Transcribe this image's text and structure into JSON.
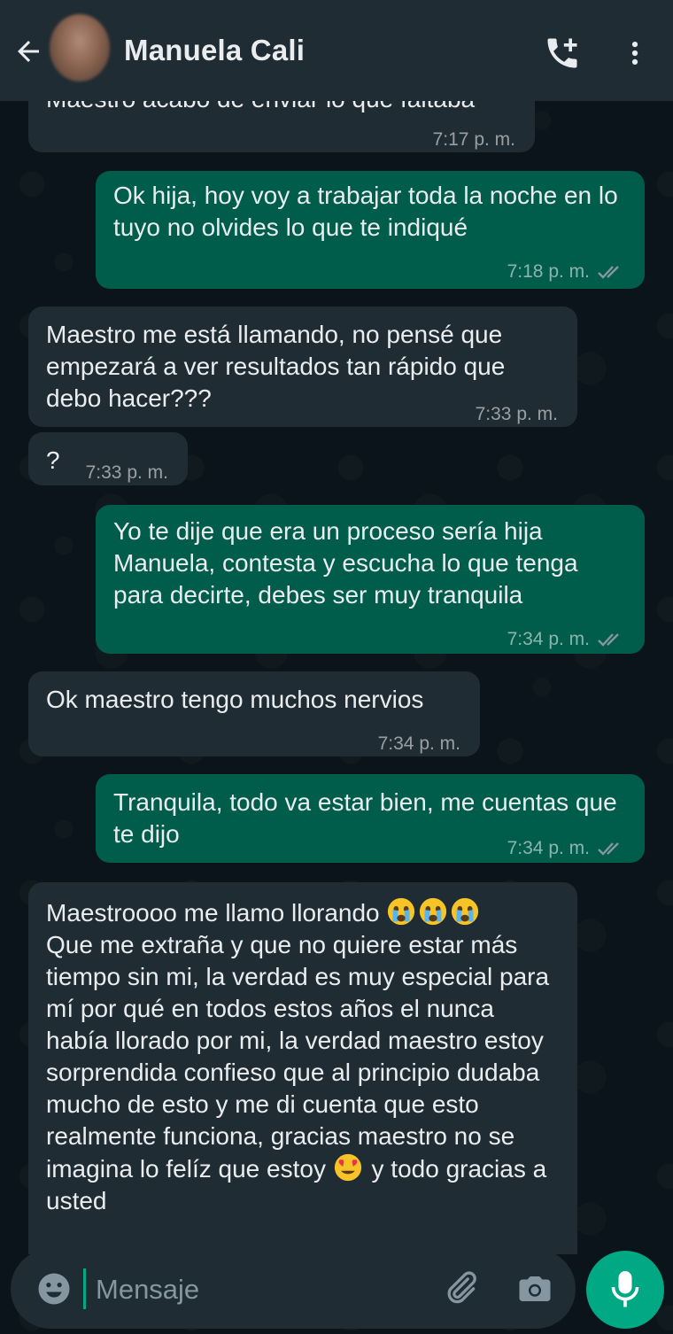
{
  "header": {
    "contact_name": "Manuela Cali"
  },
  "messages": [
    {
      "direction": "incoming",
      "text": "Maestro acabo de enviar lo que faltaba",
      "time": "7:17 p. m."
    },
    {
      "direction": "outgoing",
      "text": "Ok hija, hoy voy a trabajar toda la noche en lo tuyo no olvides lo que te indiqué",
      "time": "7:18 p. m.",
      "status": "read"
    },
    {
      "direction": "incoming",
      "text": "Maestro me está llamando, no pensé que empezará a ver resultados tan rápido que debo hacer???",
      "time": "7:33 p. m."
    },
    {
      "direction": "incoming",
      "text": "?",
      "time": "7:33 p. m."
    },
    {
      "direction": "outgoing",
      "text": "Yo te dije que era un proceso sería hija Manuela, contesta y escucha lo que tenga para decirte, debes ser muy tranquila",
      "time": "7:34 p. m.",
      "status": "read"
    },
    {
      "direction": "incoming",
      "text": "Ok maestro tengo muchos nervios",
      "time": "7:34 p. m."
    },
    {
      "direction": "outgoing",
      "text": "Tranquila, todo va estar bien, me cuentas que te dijo",
      "time": "7:34 p. m.",
      "status": "read"
    },
    {
      "direction": "incoming",
      "text_part1": "Maestroooo me llamo llorando",
      "text_part2": "Que me extraña y que no quiere estar más tiempo sin mi, la verdad es muy especial para mí por qué en todos estos años el nunca había llorado por mi, la verdad maestro estoy sorprendida confieso que al principio dudaba mucho de esto y me di cuenta que esto realmente funciona, gracias maestro no se imagina lo felíz que estoy",
      "text_part3": "y todo gracias a usted",
      "emojis": [
        "crying-face",
        "crying-face",
        "crying-face",
        "heart-eyes-face"
      ]
    }
  ],
  "input": {
    "placeholder": "Mensaje"
  },
  "colors": {
    "header_bg": "#1f2c33",
    "chat_bg": "#0b141a",
    "incoming_bubble": "#202c33",
    "outgoing_bubble": "#005c4b",
    "accent": "#00a884",
    "read_ticks": "#8696a0"
  }
}
